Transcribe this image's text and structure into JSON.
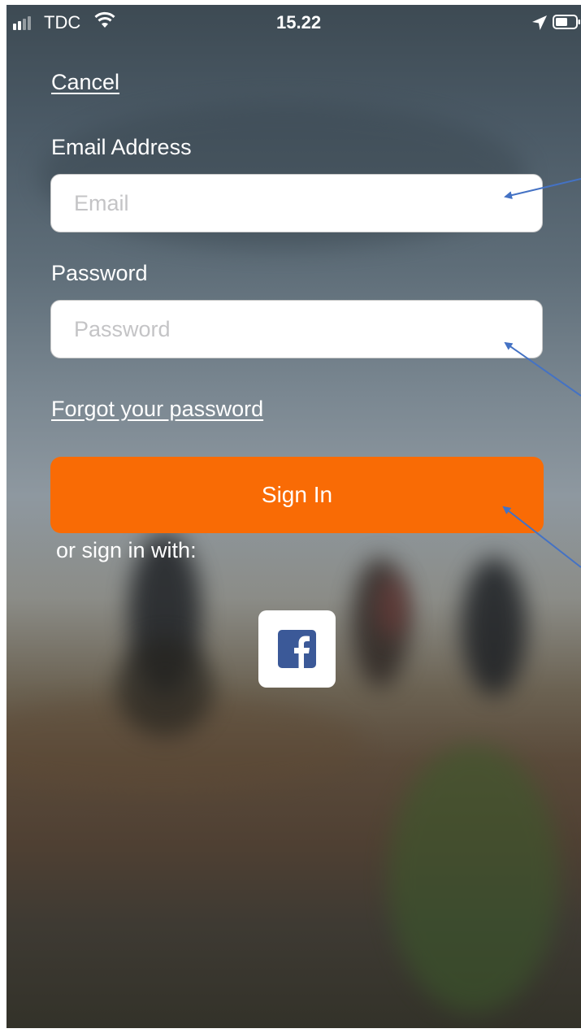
{
  "status_bar": {
    "carrier": "TDC",
    "time": "15.22",
    "icons": [
      "signal-icon",
      "wifi-icon",
      "location-icon",
      "battery-icon"
    ]
  },
  "form": {
    "cancel_label": "Cancel",
    "email_label": "Email Address",
    "email_placeholder": "Email",
    "email_value": "",
    "password_label": "Password",
    "password_placeholder": "Password",
    "password_value": "",
    "forgot_label": "Forgot your password",
    "sign_in_label": "Sign In",
    "or_label": "or sign in with:",
    "social_icon": "facebook-icon"
  },
  "colors": {
    "accent": "#f96b05",
    "facebook": "#3b5998",
    "annotation_arrow": "#4472c4"
  }
}
